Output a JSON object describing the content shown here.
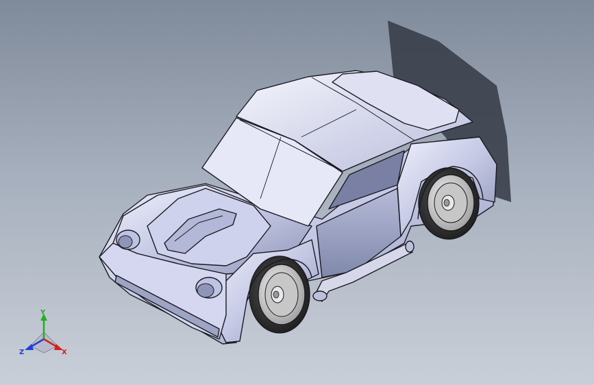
{
  "viewport": {
    "model": "car-body-assembly"
  },
  "triad": {
    "x_label": "X",
    "y_label": "Y",
    "z_label": "Z",
    "x_color": "#d42020",
    "y_color": "#20b020",
    "z_color": "#2040d8"
  },
  "colors": {
    "body": "#c8cce8",
    "body_shadow": "#9aa0c0",
    "outline": "#1a1a22",
    "tire": "#2a2a2a",
    "rim": "#d4d4d4",
    "ground_shadow": "#3a3f4a"
  }
}
